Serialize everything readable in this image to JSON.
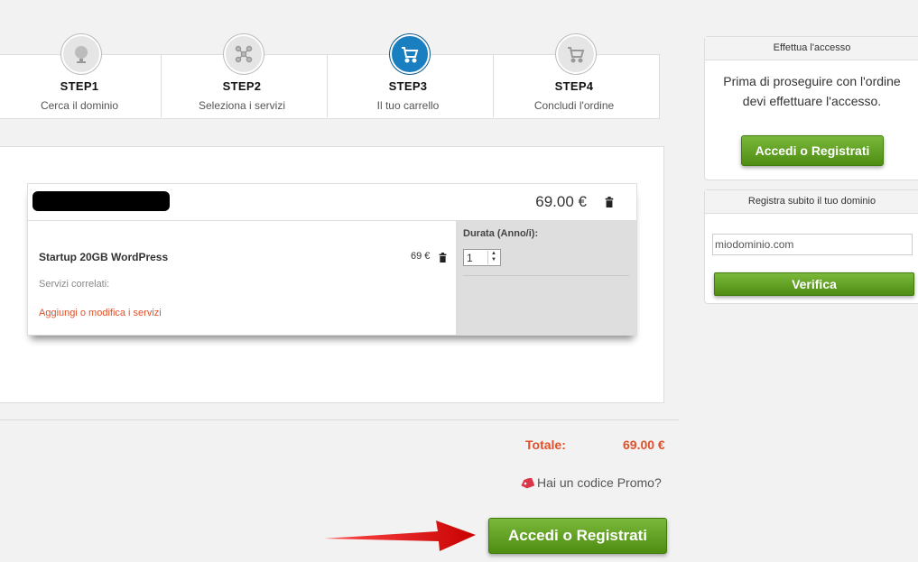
{
  "steps": [
    {
      "title": "STEP1",
      "subtitle": "Cerca il dominio",
      "icon": "globe-icon"
    },
    {
      "title": "STEP2",
      "subtitle": "Seleziona i servizi",
      "icon": "network-icon"
    },
    {
      "title": "STEP3",
      "subtitle": "Il tuo carrello",
      "icon": "cart-icon",
      "active": true
    },
    {
      "title": "STEP4",
      "subtitle": "Concludi l'ordine",
      "icon": "cart-icon"
    }
  ],
  "cart": {
    "item_price": "69.00 €",
    "product_name": "Startup 20GB WordPress",
    "product_price": "69 €",
    "related_label": "Servizi correlati:",
    "related_link": "Aggiungi o modifica i servizi",
    "duration_label": "Durata (Anno/i):",
    "duration_value": "1"
  },
  "totals": {
    "label": "Totale:",
    "value": "69.00 €",
    "promo": "Hai un codice Promo?",
    "main_button": "Accedi o Registrati"
  },
  "sidebar": {
    "login_header": "Effettua l'accesso",
    "login_text_1": "Prima di proseguire con l'ordine",
    "login_text_2": "devi effettuare l'accesso.",
    "login_button": "Accedi o Registrati",
    "domain_header": "Registra subito il tuo dominio",
    "domain_placeholder": "miodominio.com",
    "domain_button": "Verifica"
  },
  "colors": {
    "accent_orange": "#e0502a",
    "green_button": "#5f9e22",
    "active_step_blue": "#1a7fc1",
    "arrow_red": "#e01010"
  }
}
